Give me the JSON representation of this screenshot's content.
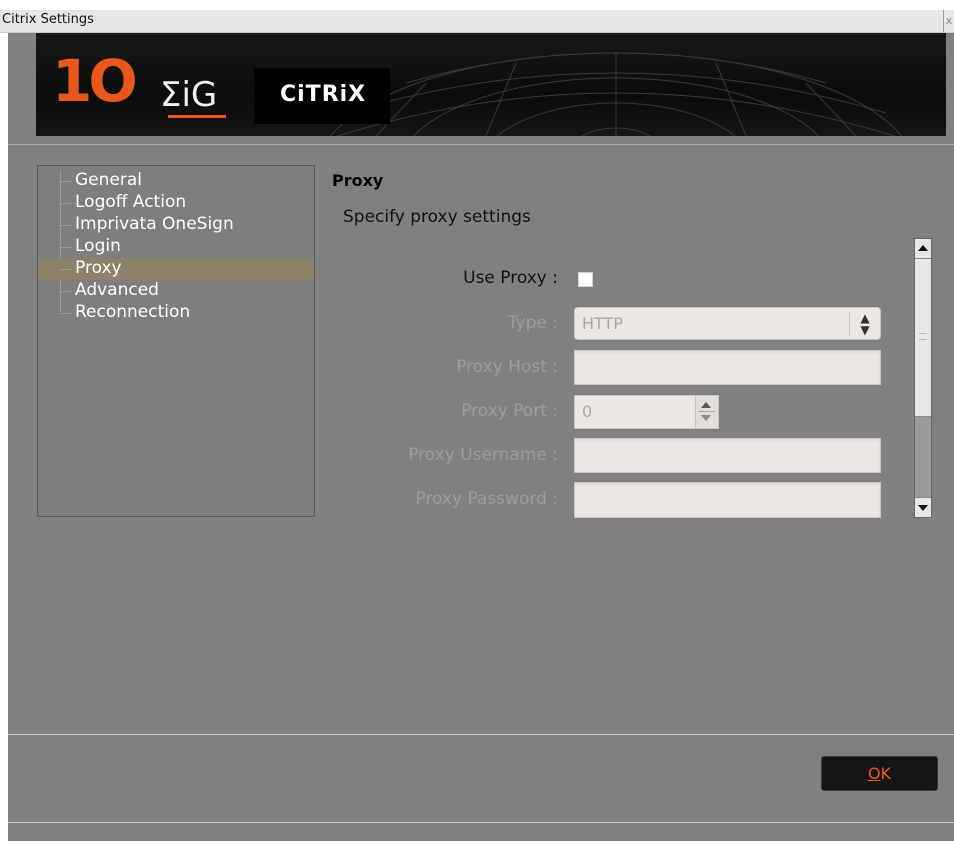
{
  "window": {
    "title": "Citrix Settings",
    "close_glyph": "x"
  },
  "banner": {
    "brand_number": "1O",
    "brand_suffix": "ΣiG",
    "partner_logo": "CiTRiX"
  },
  "sidebar": {
    "items": [
      {
        "label": "General",
        "selected": false
      },
      {
        "label": "Logoff Action",
        "selected": false
      },
      {
        "label": "Imprivata OneSign",
        "selected": false
      },
      {
        "label": "Login",
        "selected": false
      },
      {
        "label": "Proxy",
        "selected": true
      },
      {
        "label": "Advanced",
        "selected": false
      },
      {
        "label": "Reconnection",
        "selected": false
      }
    ]
  },
  "main": {
    "title": "Proxy",
    "description": "Specify proxy settings",
    "fields": {
      "use_proxy": {
        "label": "Use Proxy :",
        "checked": false
      },
      "type": {
        "label": "Type :",
        "value": "HTTP"
      },
      "host": {
        "label": "Proxy Host :",
        "value": ""
      },
      "port": {
        "label": "Proxy Port :",
        "value": "0"
      },
      "username": {
        "label": "Proxy Username :",
        "value": ""
      },
      "password": {
        "label": "Proxy Password :",
        "value": ""
      }
    }
  },
  "footer": {
    "ok_accel": "O",
    "ok_rest": "K"
  },
  "colors": {
    "accent": "#e8581c",
    "panel": "#808080",
    "selected": "#8c826a"
  }
}
